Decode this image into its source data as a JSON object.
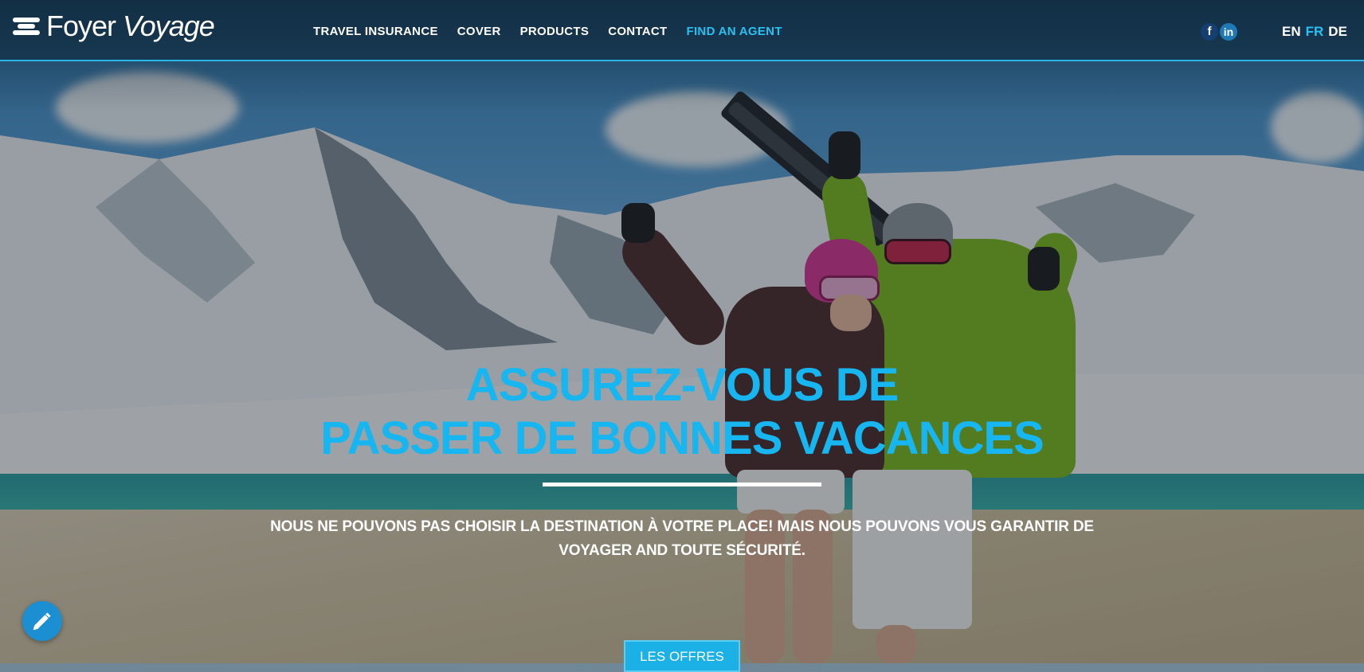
{
  "brand": {
    "logo_first": "Foyer",
    "logo_second": "Voyage"
  },
  "nav": {
    "items": [
      {
        "label": "TRAVEL INSURANCE"
      },
      {
        "label": "COVER"
      },
      {
        "label": "PRODUCTS"
      },
      {
        "label": "CONTACT"
      },
      {
        "label": "FIND AN AGENT",
        "active": true
      }
    ]
  },
  "social": {
    "facebook": "f",
    "linkedin": "in"
  },
  "languages": [
    {
      "code": "EN"
    },
    {
      "code": "FR",
      "active": true
    },
    {
      "code": "DE"
    }
  ],
  "hero": {
    "title_line1": "ASSUREZ-VOUS DE",
    "title_line2": "PASSER DE BONNES VACANCES",
    "subtitle_line1": "NOUS NE POUVONS PAS CHOISIR LA DESTINATION À VOTRE PLACE! MAIS NOUS POUVONS VOUS GARANTIR DE",
    "subtitle_line2": "VOYAGER AND TOUTE SÉCURITÉ.",
    "cta_label": "LES OFFRES"
  },
  "colors": {
    "accent": "#18b6f0",
    "header_border": "#2bb6e8",
    "edit_button": "#1b8fd2"
  },
  "icons": {
    "edit": "pencil-icon",
    "facebook": "facebook-icon",
    "linkedin": "linkedin-icon",
    "logo": "foyer-logo-mark"
  }
}
